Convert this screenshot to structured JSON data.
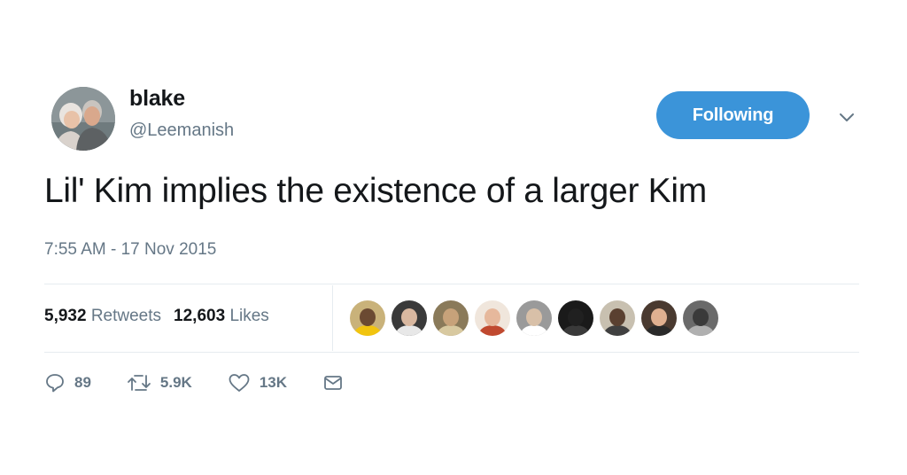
{
  "user": {
    "display_name": "blake",
    "handle": "@Leemanish",
    "avatar_icon": "profile-photo"
  },
  "follow_button": {
    "label": "Following",
    "color": "#3b94d9"
  },
  "menu": {
    "icon": "chevron-down-icon"
  },
  "tweet": {
    "text": "Lil' Kim implies the existence of a larger Kim",
    "timestamp": "7:55 AM - 17 Nov 2015"
  },
  "stats": {
    "retweets_count": "5,932",
    "retweets_label": "Retweets",
    "likes_count": "12,603",
    "likes_label": "Likes"
  },
  "likers": [
    {
      "name": "liker-avatar-1",
      "bg": "#c9b27a",
      "skin": "#6b4a32",
      "cloth": "#f1c40f"
    },
    {
      "name": "liker-avatar-2",
      "bg": "#3a3a3a",
      "skin": "#d9b8a0",
      "cloth": "#e8e8e8"
    },
    {
      "name": "liker-avatar-3",
      "bg": "#8a7a5a",
      "skin": "#c7a27a",
      "cloth": "#d8c9a0"
    },
    {
      "name": "liker-avatar-4",
      "bg": "#f0e6dc",
      "skin": "#e6b89c",
      "cloth": "#c0492f"
    },
    {
      "name": "liker-avatar-5",
      "bg": "#9a9a9a",
      "skin": "#d8c0a8",
      "cloth": "#ffffff"
    },
    {
      "name": "liker-avatar-6",
      "bg": "#1a1a1a",
      "skin": "#202020",
      "cloth": "#3a3a3a"
    },
    {
      "name": "liker-avatar-7",
      "bg": "#c8c0b0",
      "skin": "#5a4030",
      "cloth": "#404040"
    },
    {
      "name": "liker-avatar-8",
      "bg": "#4a3a30",
      "skin": "#e0b090",
      "cloth": "#2a2a2a"
    },
    {
      "name": "liker-avatar-9",
      "bg": "#6a6a6a",
      "skin": "#3a3a3a",
      "cloth": "#b0b0b0"
    }
  ],
  "actions": {
    "reply_count": "89",
    "retweet_count": "5.9K",
    "like_count": "13K"
  },
  "colors": {
    "text_primary": "#14171a",
    "text_secondary": "#657786",
    "divider": "#e6ecf0",
    "accent": "#3b94d9"
  }
}
